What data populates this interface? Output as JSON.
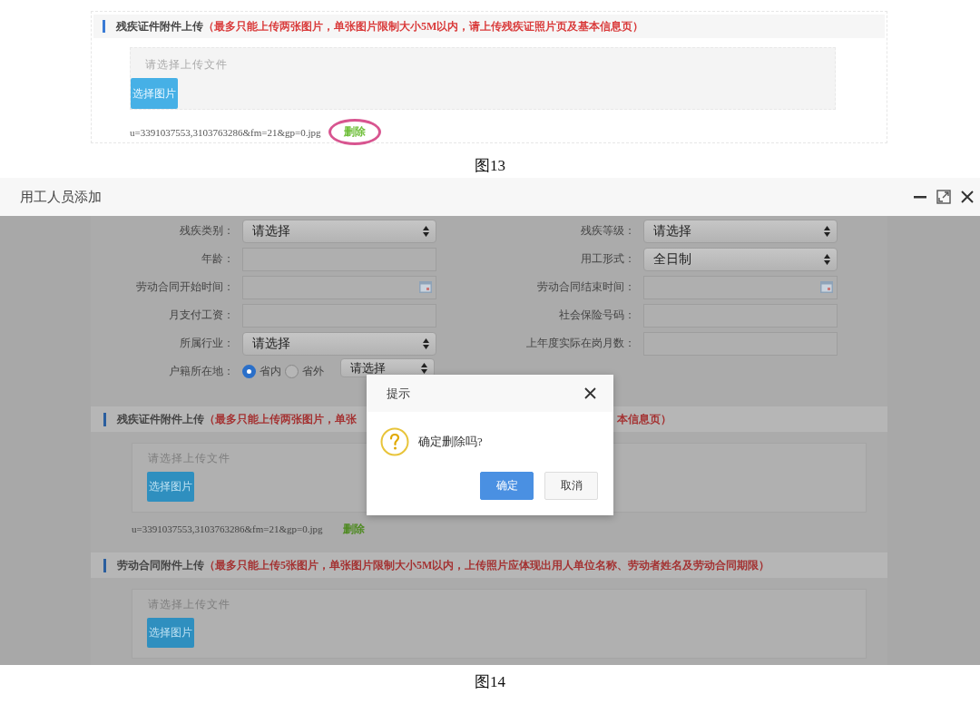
{
  "figure13": {
    "section": {
      "title": "残疾证件附件上传",
      "hint": "（最多只能上传两张图片，单张图片限制大小5M以内，请上传残疾证照片页及基本信息页）"
    },
    "upload": {
      "placeholder": "请选择上传文件",
      "button": "选择图片"
    },
    "file": {
      "name": "u=3391037553,3103763286&fm=21&gp=0.jpg",
      "delete": "删除",
      "highlighted": true
    },
    "caption": "图13"
  },
  "figure14": {
    "window": {
      "title": "用工人员添加"
    },
    "form": {
      "rows": [
        [
          {
            "label": "残疾类别：",
            "kind": "select",
            "value": "请选择"
          },
          {
            "label": "残疾等级：",
            "kind": "select",
            "value": "请选择"
          }
        ],
        [
          {
            "label": "年龄：",
            "kind": "text"
          },
          {
            "label": "用工形式：",
            "kind": "select",
            "value": "全日制"
          }
        ],
        [
          {
            "label": "劳动合同开始时间：",
            "kind": "date"
          },
          {
            "label": "劳动合同结束时间：",
            "kind": "date"
          }
        ],
        [
          {
            "label": "月支付工资：",
            "kind": "text"
          },
          {
            "label": "社会保险号码：",
            "kind": "text"
          }
        ],
        [
          {
            "label": "所属行业：",
            "kind": "select",
            "value": "请选择"
          },
          {
            "label": "上年度实际在岗月数：",
            "kind": "text"
          }
        ],
        [
          {
            "label": "户籍所在地：",
            "kind": "radio",
            "options": [
              {
                "label": "省内",
                "selected": true
              },
              {
                "label": "省外",
                "selected": false
              }
            ],
            "select": "请选择"
          }
        ]
      ]
    },
    "sections": [
      {
        "title": "残疾证件附件上传",
        "hint": "（最多只能上传两张图片，单张",
        "hint_tail": "本信息页）",
        "upload": {
          "placeholder": "请选择上传文件",
          "button": "选择图片"
        },
        "file": {
          "name": "u=3391037553,3103763286&fm=21&gp=0.jpg",
          "delete": "删除"
        }
      },
      {
        "title": "劳动合同附件上传",
        "hint": "（最多只能上传5张图片，单张图片限制大小5M以内，上传照片应体现出用人单位名称、劳动者姓名及劳动合同期限）",
        "upload": {
          "placeholder": "请选择上传文件",
          "button": "选择图片"
        }
      }
    ],
    "dialog": {
      "title": "提示",
      "message": "确定删除吗?",
      "buttons": [
        {
          "label": "确定",
          "kind": "primary"
        },
        {
          "label": "取消",
          "kind": "default"
        }
      ]
    },
    "caption": "图14"
  }
}
